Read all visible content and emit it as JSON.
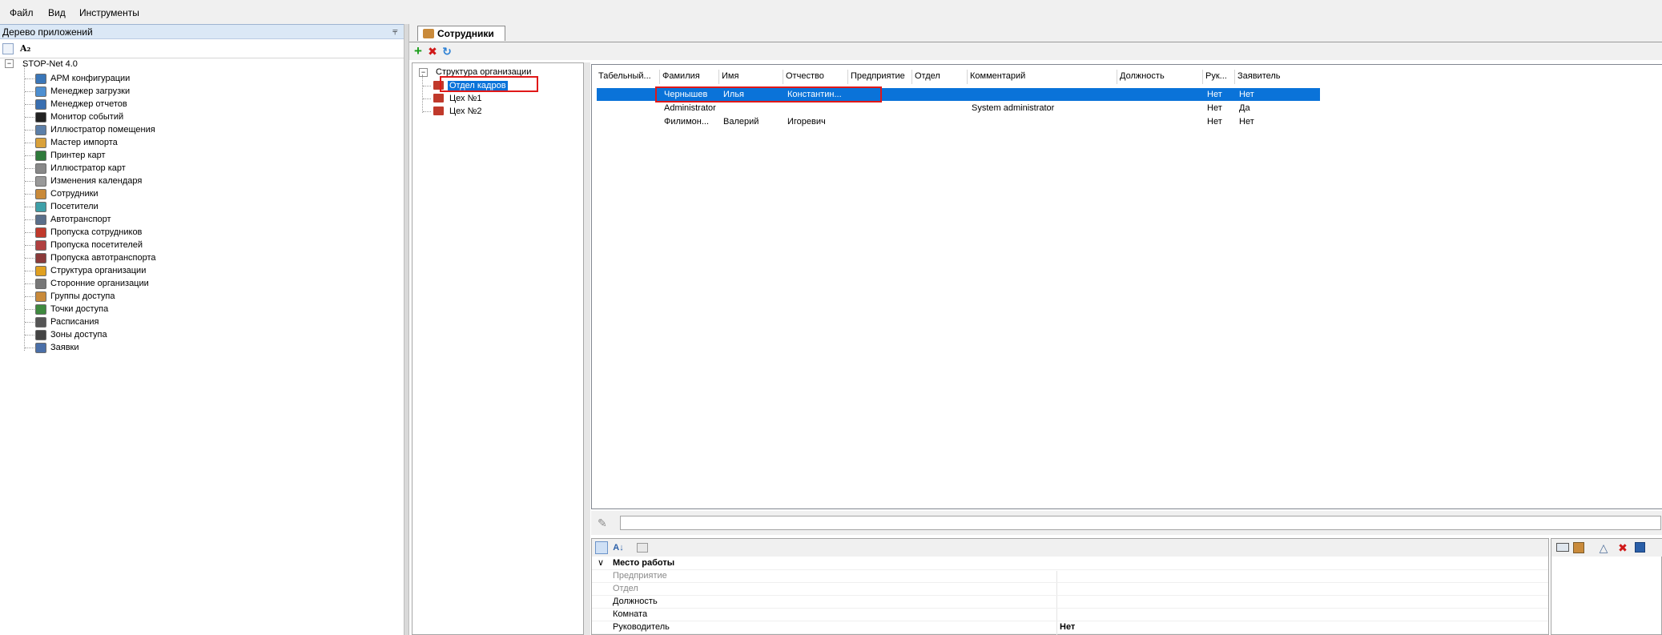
{
  "menu": [
    "Файл",
    "Вид",
    "Инструменты"
  ],
  "left_panel": {
    "title": "Дерево приложений",
    "sort_label": "A₂",
    "root": "STOP-Net 4.0",
    "items": [
      {
        "label": "АРМ конфигурации",
        "color": "#3a76b8"
      },
      {
        "label": "Менеджер загрузки",
        "color": "#4d8fd1"
      },
      {
        "label": "Менеджер отчетов",
        "color": "#3a6fb0"
      },
      {
        "label": "Монитор событий",
        "color": "#222222"
      },
      {
        "label": "Иллюстратор помещения",
        "color": "#5c7fa8"
      },
      {
        "label": "Мастер импорта",
        "color": "#d9a13a"
      },
      {
        "label": "Принтер карт",
        "color": "#2f7a3b"
      },
      {
        "label": "Иллюстратор карт",
        "color": "#888888"
      },
      {
        "label": "Изменения календаря",
        "color": "#999999"
      },
      {
        "label": "Сотрудники",
        "color": "#c98a3a"
      },
      {
        "label": "Посетители",
        "color": "#3fa0a8"
      },
      {
        "label": "Автотранспорт",
        "color": "#5a6f8a"
      },
      {
        "label": "Пропуска сотрудников",
        "color": "#c0392b"
      },
      {
        "label": "Пропуска посетителей",
        "color": "#b04040"
      },
      {
        "label": "Пропуска автотранспорта",
        "color": "#8b3a3a"
      },
      {
        "label": "Структура организации",
        "color": "#e0a020"
      },
      {
        "label": "Сторонние организации",
        "color": "#777777"
      },
      {
        "label": "Группы доступа",
        "color": "#c98a3a"
      },
      {
        "label": "Точки доступа",
        "color": "#3f8a3f"
      },
      {
        "label": "Расписания",
        "color": "#555555"
      },
      {
        "label": "Зоны доступа",
        "color": "#444444"
      },
      {
        "label": "Заявки",
        "color": "#4a6fa8"
      }
    ]
  },
  "tab": {
    "label": "Сотрудники"
  },
  "org_tree": {
    "root": "Структура организации",
    "items": [
      "Отдел кадров",
      "Цех №1",
      "Цех №2"
    ],
    "selected_index": 0
  },
  "grid": {
    "columns": [
      "Табельный...",
      "Фамилия",
      "Имя",
      "Отчество",
      "Предприятие",
      "Отдел",
      "Комментарий",
      "Должность",
      "Рук...",
      "Заявитель"
    ],
    "rows": [
      {
        "tab": "",
        "last": "Чернышев",
        "first": "Илья",
        "middle": "Константин...",
        "company": "",
        "dept": "",
        "comment": "",
        "position": "",
        "head": "Нет",
        "applicant": "Нет"
      },
      {
        "tab": "",
        "last": "Administrator",
        "first": "",
        "middle": "",
        "company": "",
        "dept": "",
        "comment": "System administrator",
        "position": "",
        "head": "Нет",
        "applicant": "Да"
      },
      {
        "tab": "",
        "last": "Филимон...",
        "first": "Валерий",
        "middle": "Игоревич",
        "company": "",
        "dept": "",
        "comment": "",
        "position": "",
        "head": "Нет",
        "applicant": "Нет"
      }
    ],
    "selected_row": 0
  },
  "properties": {
    "group": "Место работы",
    "rows": [
      {
        "label": "Предприятие",
        "value": "",
        "disabled": true
      },
      {
        "label": "Отдел",
        "value": "",
        "disabled": true
      },
      {
        "label": "Должность",
        "value": ""
      },
      {
        "label": "Комната",
        "value": ""
      },
      {
        "label": "Руководитель",
        "value": "Нет"
      }
    ]
  },
  "colors": {
    "selection": "#0a73d9",
    "highlight_box": "#e01818",
    "panel_header": "#dbe8f6"
  }
}
